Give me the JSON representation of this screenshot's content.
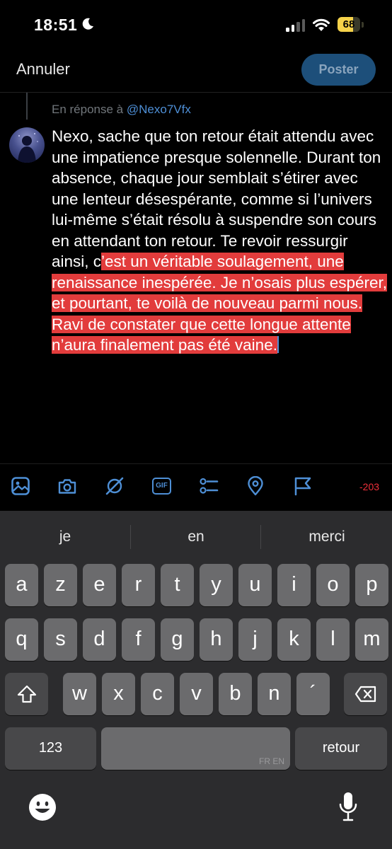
{
  "status_bar": {
    "time": "18:51",
    "battery": "68",
    "battery_level": 0.68
  },
  "header": {
    "cancel_label": "Annuler",
    "post_label": "Poster"
  },
  "reply": {
    "prefix": "En réponse à",
    "handle": "@Nexo7Vfx"
  },
  "post": {
    "text_plain": "Nexo, sache que ton retour était attendu avec une impatience presque solennelle. Durant ton absence, chaque jour semblait s’étirer avec une lenteur désespérante, comme si l’univers lui-même s’était résolu à suspendre son cours en attendant ton retour. Te revoir ressurgir ainsi, c",
    "text_highlighted": "’est un véritable soulagement, une renaissance inespérée. Je n’osais plus espérer, et pourtant, te voilà de nouveau parmi nous. Ravi de constater que cette longue attente n’aura finalement pas été vaine.",
    "highlight_color": "#e23c3c"
  },
  "toolbar": {
    "icons": [
      "image-icon",
      "camera-icon",
      "grok-icon",
      "gif-icon",
      "poll-icon",
      "location-icon",
      "flag-icon"
    ],
    "gif_label": "GIF",
    "char_counter": "-203",
    "accent": "#4e8fd6"
  },
  "keyboard": {
    "suggestions": [
      "je",
      "en",
      "merci"
    ],
    "row1": [
      "a",
      "z",
      "e",
      "r",
      "t",
      "y",
      "u",
      "i",
      "o",
      "p"
    ],
    "row2": [
      "q",
      "s",
      "d",
      "f",
      "g",
      "h",
      "j",
      "k",
      "l",
      "m"
    ],
    "row3": [
      "w",
      "x",
      "c",
      "v",
      "b",
      "n",
      "´"
    ],
    "numbers_label": "123",
    "space_lang": "FR EN",
    "return_label": "retour"
  }
}
